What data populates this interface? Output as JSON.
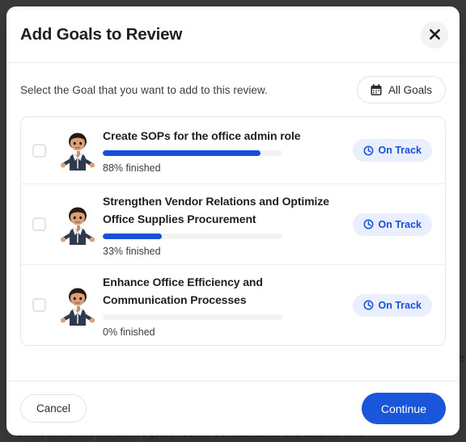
{
  "background": {
    "occluded_text": "reminded me that sometimes goals need to be reassessed and adapted to re",
    "side_text": "nrst",
    "overlay_color": "#3b3b3b"
  },
  "modal": {
    "title": "Add Goals to Review",
    "close_icon": "close-icon",
    "subtitle": "Select the Goal that you want to add to this review.",
    "filter": {
      "label": "All Goals",
      "icon": "calendar-icon"
    },
    "goals": [
      {
        "title": "Create SOPs for the office admin role",
        "progress": 88,
        "progress_label": "88% finished",
        "status": "On Track",
        "status_icon": "clock-icon",
        "checked": false,
        "avatar": "person-avatar"
      },
      {
        "title": "Strengthen Vendor Relations and Optimize Office Supplies Procurement",
        "progress": 33,
        "progress_label": "33% finished",
        "status": "On Track",
        "status_icon": "clock-icon",
        "checked": false,
        "avatar": "person-avatar"
      },
      {
        "title": "Enhance Office Efficiency and Communication Processes",
        "progress": 0,
        "progress_label": "0% finished",
        "status": "On Track",
        "status_icon": "clock-icon",
        "checked": false,
        "avatar": "person-avatar"
      }
    ],
    "footer": {
      "cancel_label": "Cancel",
      "continue_label": "Continue"
    }
  },
  "colors": {
    "accent": "#1a56db",
    "progress_fill": "#1650d8",
    "badge_bg": "#e9effc",
    "badge_text": "#1650d8",
    "track": "#f2f2f3"
  }
}
